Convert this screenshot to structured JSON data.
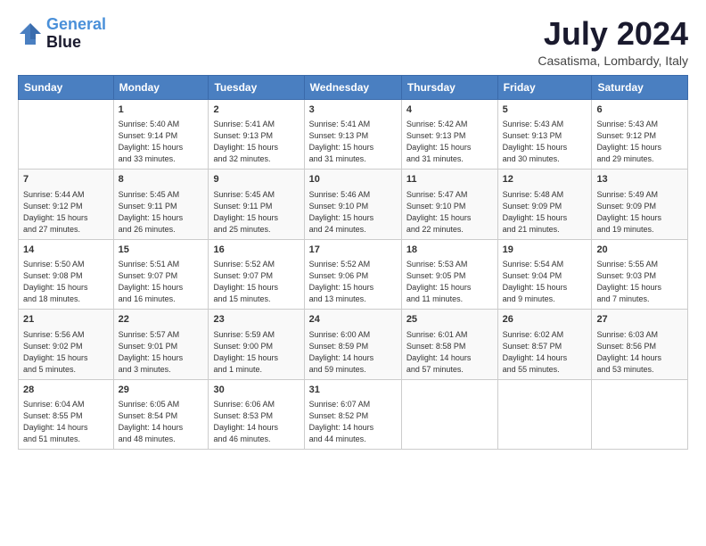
{
  "logo": {
    "line1": "General",
    "line2": "Blue"
  },
  "title": "July 2024",
  "location": "Casatisma, Lombardy, Italy",
  "days_of_week": [
    "Sunday",
    "Monday",
    "Tuesday",
    "Wednesday",
    "Thursday",
    "Friday",
    "Saturday"
  ],
  "weeks": [
    [
      {
        "day": "",
        "info": ""
      },
      {
        "day": "1",
        "info": "Sunrise: 5:40 AM\nSunset: 9:14 PM\nDaylight: 15 hours\nand 33 minutes."
      },
      {
        "day": "2",
        "info": "Sunrise: 5:41 AM\nSunset: 9:13 PM\nDaylight: 15 hours\nand 32 minutes."
      },
      {
        "day": "3",
        "info": "Sunrise: 5:41 AM\nSunset: 9:13 PM\nDaylight: 15 hours\nand 31 minutes."
      },
      {
        "day": "4",
        "info": "Sunrise: 5:42 AM\nSunset: 9:13 PM\nDaylight: 15 hours\nand 31 minutes."
      },
      {
        "day": "5",
        "info": "Sunrise: 5:43 AM\nSunset: 9:13 PM\nDaylight: 15 hours\nand 30 minutes."
      },
      {
        "day": "6",
        "info": "Sunrise: 5:43 AM\nSunset: 9:12 PM\nDaylight: 15 hours\nand 29 minutes."
      }
    ],
    [
      {
        "day": "7",
        "info": "Sunrise: 5:44 AM\nSunset: 9:12 PM\nDaylight: 15 hours\nand 27 minutes."
      },
      {
        "day": "8",
        "info": "Sunrise: 5:45 AM\nSunset: 9:11 PM\nDaylight: 15 hours\nand 26 minutes."
      },
      {
        "day": "9",
        "info": "Sunrise: 5:45 AM\nSunset: 9:11 PM\nDaylight: 15 hours\nand 25 minutes."
      },
      {
        "day": "10",
        "info": "Sunrise: 5:46 AM\nSunset: 9:10 PM\nDaylight: 15 hours\nand 24 minutes."
      },
      {
        "day": "11",
        "info": "Sunrise: 5:47 AM\nSunset: 9:10 PM\nDaylight: 15 hours\nand 22 minutes."
      },
      {
        "day": "12",
        "info": "Sunrise: 5:48 AM\nSunset: 9:09 PM\nDaylight: 15 hours\nand 21 minutes."
      },
      {
        "day": "13",
        "info": "Sunrise: 5:49 AM\nSunset: 9:09 PM\nDaylight: 15 hours\nand 19 minutes."
      }
    ],
    [
      {
        "day": "14",
        "info": "Sunrise: 5:50 AM\nSunset: 9:08 PM\nDaylight: 15 hours\nand 18 minutes."
      },
      {
        "day": "15",
        "info": "Sunrise: 5:51 AM\nSunset: 9:07 PM\nDaylight: 15 hours\nand 16 minutes."
      },
      {
        "day": "16",
        "info": "Sunrise: 5:52 AM\nSunset: 9:07 PM\nDaylight: 15 hours\nand 15 minutes."
      },
      {
        "day": "17",
        "info": "Sunrise: 5:52 AM\nSunset: 9:06 PM\nDaylight: 15 hours\nand 13 minutes."
      },
      {
        "day": "18",
        "info": "Sunrise: 5:53 AM\nSunset: 9:05 PM\nDaylight: 15 hours\nand 11 minutes."
      },
      {
        "day": "19",
        "info": "Sunrise: 5:54 AM\nSunset: 9:04 PM\nDaylight: 15 hours\nand 9 minutes."
      },
      {
        "day": "20",
        "info": "Sunrise: 5:55 AM\nSunset: 9:03 PM\nDaylight: 15 hours\nand 7 minutes."
      }
    ],
    [
      {
        "day": "21",
        "info": "Sunrise: 5:56 AM\nSunset: 9:02 PM\nDaylight: 15 hours\nand 5 minutes."
      },
      {
        "day": "22",
        "info": "Sunrise: 5:57 AM\nSunset: 9:01 PM\nDaylight: 15 hours\nand 3 minutes."
      },
      {
        "day": "23",
        "info": "Sunrise: 5:59 AM\nSunset: 9:00 PM\nDaylight: 15 hours\nand 1 minute."
      },
      {
        "day": "24",
        "info": "Sunrise: 6:00 AM\nSunset: 8:59 PM\nDaylight: 14 hours\nand 59 minutes."
      },
      {
        "day": "25",
        "info": "Sunrise: 6:01 AM\nSunset: 8:58 PM\nDaylight: 14 hours\nand 57 minutes."
      },
      {
        "day": "26",
        "info": "Sunrise: 6:02 AM\nSunset: 8:57 PM\nDaylight: 14 hours\nand 55 minutes."
      },
      {
        "day": "27",
        "info": "Sunrise: 6:03 AM\nSunset: 8:56 PM\nDaylight: 14 hours\nand 53 minutes."
      }
    ],
    [
      {
        "day": "28",
        "info": "Sunrise: 6:04 AM\nSunset: 8:55 PM\nDaylight: 14 hours\nand 51 minutes."
      },
      {
        "day": "29",
        "info": "Sunrise: 6:05 AM\nSunset: 8:54 PM\nDaylight: 14 hours\nand 48 minutes."
      },
      {
        "day": "30",
        "info": "Sunrise: 6:06 AM\nSunset: 8:53 PM\nDaylight: 14 hours\nand 46 minutes."
      },
      {
        "day": "31",
        "info": "Sunrise: 6:07 AM\nSunset: 8:52 PM\nDaylight: 14 hours\nand 44 minutes."
      },
      {
        "day": "",
        "info": ""
      },
      {
        "day": "",
        "info": ""
      },
      {
        "day": "",
        "info": ""
      }
    ]
  ]
}
